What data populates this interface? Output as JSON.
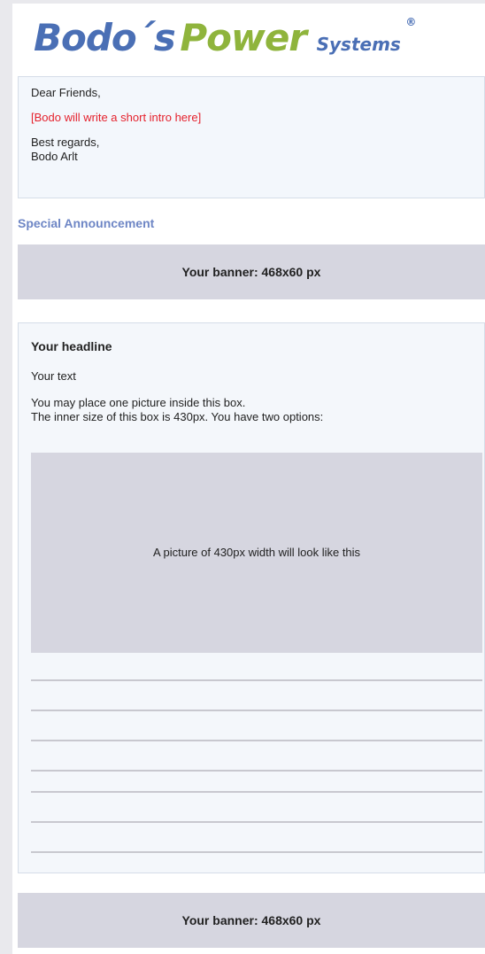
{
  "logo": {
    "word1": "Bodo´s",
    "word2": "Power",
    "word3": "Systems",
    "registered": "®"
  },
  "intro": {
    "greeting": "Dear Friends,",
    "placeholder": "[Bodo will write a short intro here]",
    "regards": "Best regards,",
    "name": "Bodo Arlt"
  },
  "special_heading": "Special Announcement",
  "banner_top": "Your banner: 468x60 px",
  "content": {
    "headline": "Your headline",
    "text": "Your text",
    "info_line1": "You may place one picture inside this box.",
    "info_line2": "The inner size of this box is 430px. You have two options:",
    "picture_label": "A picture of 430px width will look like this"
  },
  "banner_bottom": "Your banner: 468x60 px",
  "colors": {
    "logo_blue": "#4a6fb5",
    "logo_green": "#8fb43c",
    "intro_red": "#e5222d",
    "heading_blue": "#6e86c5",
    "banner_gray": "#d6d6e0"
  }
}
